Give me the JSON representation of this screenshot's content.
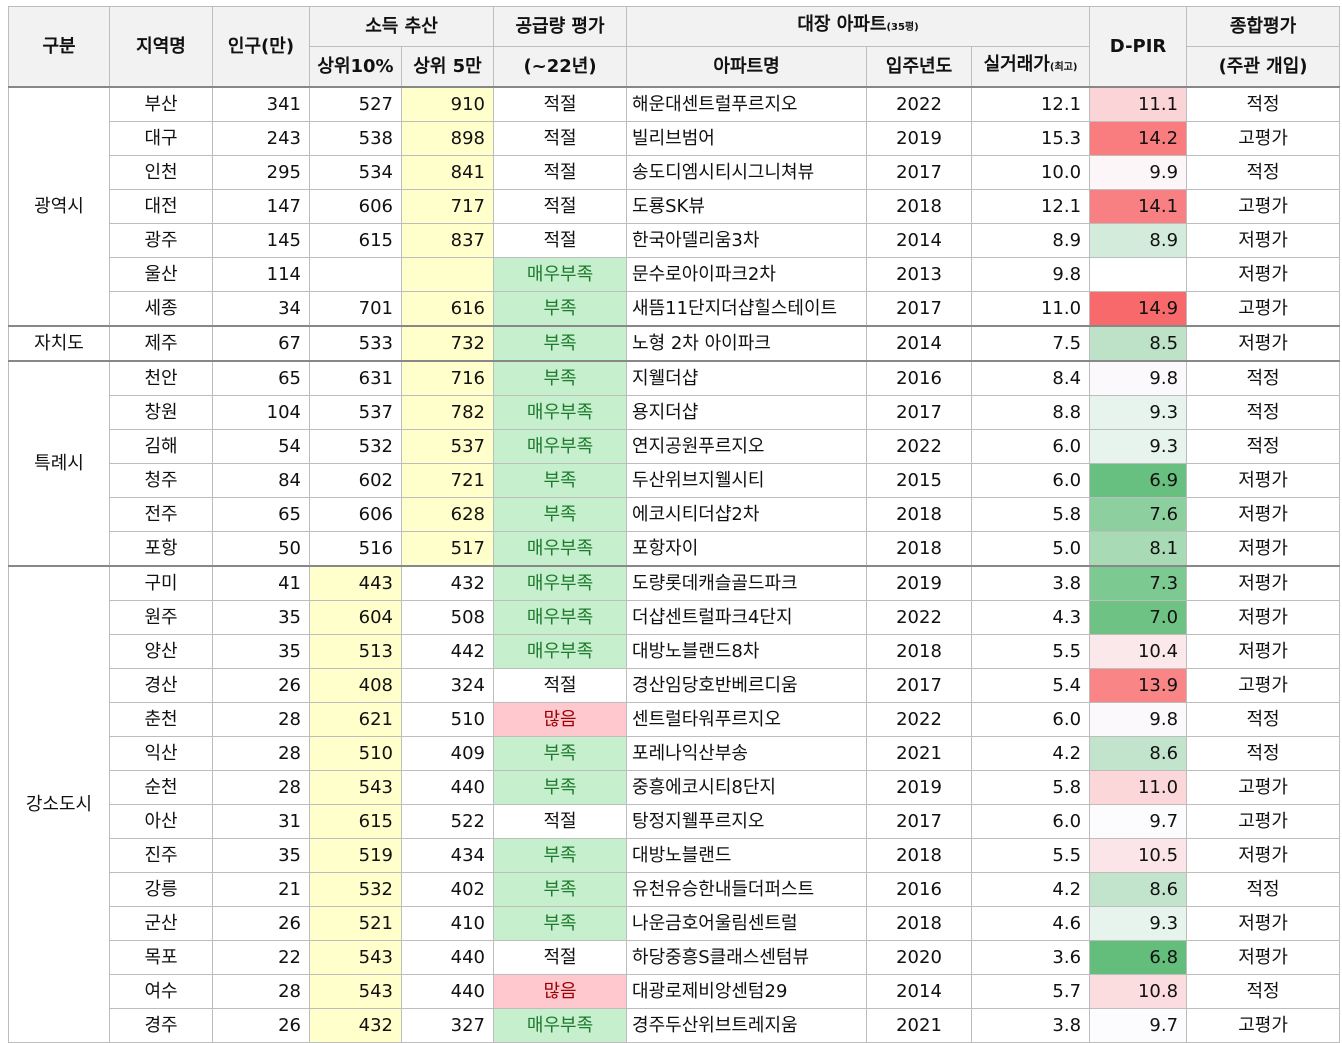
{
  "header": {
    "category": "구분",
    "region": "지역명",
    "population": "인구(만)",
    "income_group": "소득 추산",
    "income_top10": "상위10%",
    "income_top5man": "상위 5만",
    "supply": "공급량 평가",
    "supply_sub": "(~22년)",
    "apt_group": "대장 아파트",
    "apt_group_unit": "(35평)",
    "apt_name": "아파트명",
    "year": "입주년도",
    "price": "실거래가",
    "price_unit": "(최고)",
    "dpir": "D-PIR",
    "overall": "종합평가",
    "overall_sub": "(주관 개입)"
  },
  "groups": [
    {
      "name": "광역시",
      "start": 0,
      "span": 7
    },
    {
      "name": "자치도",
      "start": 7,
      "span": 1
    },
    {
      "name": "특례시",
      "start": 8,
      "span": 6
    },
    {
      "name": "강소도시",
      "start": 14,
      "span": 14
    }
  ],
  "colors": {
    "dpir_low": "#63be7b",
    "dpir_mid": "#fcfcff",
    "dpir_high": "#f8696b",
    "highlight": "#ffffcc"
  },
  "rows": [
    {
      "region": "부산",
      "pop": "341",
      "top10": "527",
      "top5": "910",
      "hl": "top5",
      "supply": "적절",
      "apt": "해운대센트럴푸르지오",
      "year": "2022",
      "price": "12.1",
      "dpir": "11.1",
      "overall": "적정"
    },
    {
      "region": "대구",
      "pop": "243",
      "top10": "538",
      "top5": "898",
      "hl": "top5",
      "supply": "적절",
      "apt": "빌리브범어",
      "year": "2019",
      "price": "15.3",
      "dpir": "14.2",
      "overall": "고평가"
    },
    {
      "region": "인천",
      "pop": "295",
      "top10": "534",
      "top5": "841",
      "hl": "top5",
      "supply": "적절",
      "apt": "송도디엠시티시그니쳐뷰",
      "year": "2017",
      "price": "10.0",
      "dpir": "9.9",
      "overall": "적정"
    },
    {
      "region": "대전",
      "pop": "147",
      "top10": "606",
      "top5": "717",
      "hl": "top5",
      "supply": "적절",
      "apt": "도룡SK뷰",
      "year": "2018",
      "price": "12.1",
      "dpir": "14.1",
      "overall": "고평가"
    },
    {
      "region": "광주",
      "pop": "145",
      "top10": "615",
      "top5": "837",
      "hl": "top5",
      "supply": "적절",
      "apt": "한국아델리움3차",
      "year": "2014",
      "price": "8.9",
      "dpir": "8.9",
      "overall": "저평가"
    },
    {
      "region": "울산",
      "pop": "114",
      "top10": "",
      "top5": "",
      "hl": "top5",
      "supply": "매우부족",
      "apt": "문수로아이파크2차",
      "year": "2013",
      "price": "9.8",
      "dpir": "",
      "overall": "저평가"
    },
    {
      "region": "세종",
      "pop": "34",
      "top10": "701",
      "top5": "616",
      "hl": "top5",
      "supply": "부족",
      "apt": "새뜸11단지더샵힐스테이트",
      "year": "2017",
      "price": "11.0",
      "dpir": "14.9",
      "overall": "고평가"
    },
    {
      "region": "제주",
      "pop": "67",
      "top10": "533",
      "top5": "732",
      "hl": "top5",
      "supply": "부족",
      "apt": "노형 2차 아이파크",
      "year": "2014",
      "price": "7.5",
      "dpir": "8.5",
      "overall": "저평가"
    },
    {
      "region": "천안",
      "pop": "65",
      "top10": "631",
      "top5": "716",
      "hl": "top5",
      "supply": "부족",
      "apt": "지웰더샵",
      "year": "2016",
      "price": "8.4",
      "dpir": "9.8",
      "overall": "적정"
    },
    {
      "region": "창원",
      "pop": "104",
      "top10": "537",
      "top5": "782",
      "hl": "top5",
      "supply": "매우부족",
      "apt": "용지더샵",
      "year": "2017",
      "price": "8.8",
      "dpir": "9.3",
      "overall": "적정"
    },
    {
      "region": "김해",
      "pop": "54",
      "top10": "532",
      "top5": "537",
      "hl": "top5",
      "supply": "매우부족",
      "apt": "연지공원푸르지오",
      "year": "2022",
      "price": "6.0",
      "dpir": "9.3",
      "overall": "적정"
    },
    {
      "region": "청주",
      "pop": "84",
      "top10": "602",
      "top5": "721",
      "hl": "top5",
      "supply": "부족",
      "apt": "두산위브지웰시티",
      "year": "2015",
      "price": "6.0",
      "dpir": "6.9",
      "overall": "저평가"
    },
    {
      "region": "전주",
      "pop": "65",
      "top10": "606",
      "top5": "628",
      "hl": "top5",
      "supply": "부족",
      "apt": "에코시티더샵2차",
      "year": "2018",
      "price": "5.8",
      "dpir": "7.6",
      "overall": "저평가"
    },
    {
      "region": "포항",
      "pop": "50",
      "top10": "516",
      "top5": "517",
      "hl": "top5",
      "supply": "매우부족",
      "apt": "포항자이",
      "year": "2018",
      "price": "5.0",
      "dpir": "8.1",
      "overall": "저평가"
    },
    {
      "region": "구미",
      "pop": "41",
      "top10": "443",
      "top5": "432",
      "hl": "top10",
      "supply": "매우부족",
      "apt": "도량롯데캐슬골드파크",
      "year": "2019",
      "price": "3.8",
      "dpir": "7.3",
      "overall": "저평가"
    },
    {
      "region": "원주",
      "pop": "35",
      "top10": "604",
      "top5": "508",
      "hl": "top10",
      "supply": "매우부족",
      "apt": "더샵센트럴파크4단지",
      "year": "2022",
      "price": "4.3",
      "dpir": "7.0",
      "overall": "저평가"
    },
    {
      "region": "양산",
      "pop": "35",
      "top10": "513",
      "top5": "442",
      "hl": "top10",
      "supply": "매우부족",
      "apt": "대방노블랜드8차",
      "year": "2018",
      "price": "5.5",
      "dpir": "10.4",
      "overall": "저평가"
    },
    {
      "region": "경산",
      "pop": "26",
      "top10": "408",
      "top5": "324",
      "hl": "top10",
      "supply": "적절",
      "apt": "경산임당호반베르디움",
      "year": "2017",
      "price": "5.4",
      "dpir": "13.9",
      "overall": "고평가"
    },
    {
      "region": "춘천",
      "pop": "28",
      "top10": "621",
      "top5": "510",
      "hl": "top10",
      "supply": "많음",
      "apt": "센트럴타워푸르지오",
      "year": "2022",
      "price": "6.0",
      "dpir": "9.8",
      "overall": "적정"
    },
    {
      "region": "익산",
      "pop": "28",
      "top10": "510",
      "top5": "409",
      "hl": "top10",
      "supply": "부족",
      "apt": "포레나익산부송",
      "year": "2021",
      "price": "4.2",
      "dpir": "8.6",
      "overall": "적정"
    },
    {
      "region": "순천",
      "pop": "28",
      "top10": "543",
      "top5": "440",
      "hl": "top10",
      "supply": "부족",
      "apt": "중흥에코시티8단지",
      "year": "2019",
      "price": "5.8",
      "dpir": "11.0",
      "overall": "고평가"
    },
    {
      "region": "아산",
      "pop": "31",
      "top10": "615",
      "top5": "522",
      "hl": "top10",
      "supply": "적절",
      "apt": "탕정지웰푸르지오",
      "year": "2017",
      "price": "6.0",
      "dpir": "9.7",
      "overall": "고평가"
    },
    {
      "region": "진주",
      "pop": "35",
      "top10": "519",
      "top5": "434",
      "hl": "top10",
      "supply": "부족",
      "apt": "대방노블랜드",
      "year": "2018",
      "price": "5.5",
      "dpir": "10.5",
      "overall": "저평가"
    },
    {
      "region": "강릉",
      "pop": "21",
      "top10": "532",
      "top5": "402",
      "hl": "top10",
      "supply": "부족",
      "apt": "유천유승한내들더퍼스트",
      "year": "2016",
      "price": "4.2",
      "dpir": "8.6",
      "overall": "적정"
    },
    {
      "region": "군산",
      "pop": "26",
      "top10": "521",
      "top5": "410",
      "hl": "top10",
      "supply": "부족",
      "apt": "나운금호어울림센트럴",
      "year": "2018",
      "price": "4.6",
      "dpir": "9.3",
      "overall": "저평가"
    },
    {
      "region": "목포",
      "pop": "22",
      "top10": "543",
      "top5": "440",
      "hl": "top10",
      "supply": "적절",
      "apt": "하당중흥S클래스센텀뷰",
      "year": "2020",
      "price": "3.6",
      "dpir": "6.8",
      "overall": "저평가"
    },
    {
      "region": "여수",
      "pop": "28",
      "top10": "543",
      "top5": "440",
      "hl": "top10",
      "supply": "많음",
      "apt": "대광로제비앙센텀29",
      "year": "2014",
      "price": "5.7",
      "dpir": "10.8",
      "overall": "적정"
    },
    {
      "region": "경주",
      "pop": "26",
      "top10": "432",
      "top5": "327",
      "hl": "top10",
      "supply": "매우부족",
      "apt": "경주두산위브트레지움",
      "year": "2021",
      "price": "3.8",
      "dpir": "9.7",
      "overall": "고평가"
    }
  ]
}
